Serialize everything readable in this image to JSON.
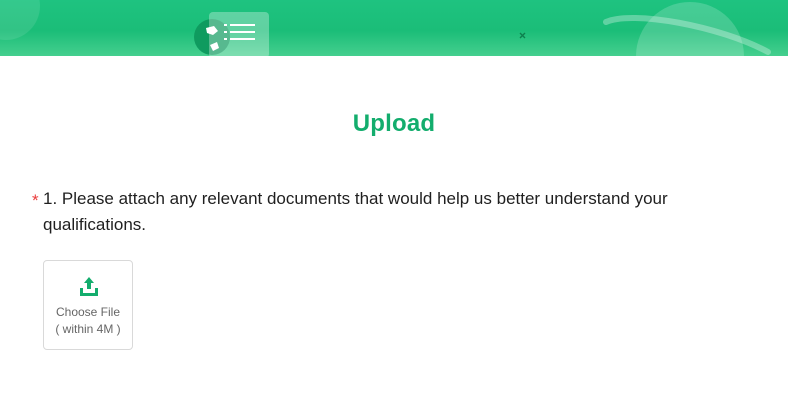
{
  "banner": {
    "accent_color": "#1bbd78",
    "icons": [
      "header-logo-icon",
      "menu-list-icon",
      "sparkle-icon",
      "planet-icon"
    ]
  },
  "form": {
    "title": "Upload",
    "title_color": "#13ad6d",
    "question": {
      "required_mark": "*",
      "required_color": "#ea3b3b",
      "text": "1. Please attach any relevant documents that would help us better understand your qualifications."
    },
    "upload": {
      "icon": "upload-icon",
      "label": "Choose File",
      "limit": "( within 4M )"
    }
  }
}
